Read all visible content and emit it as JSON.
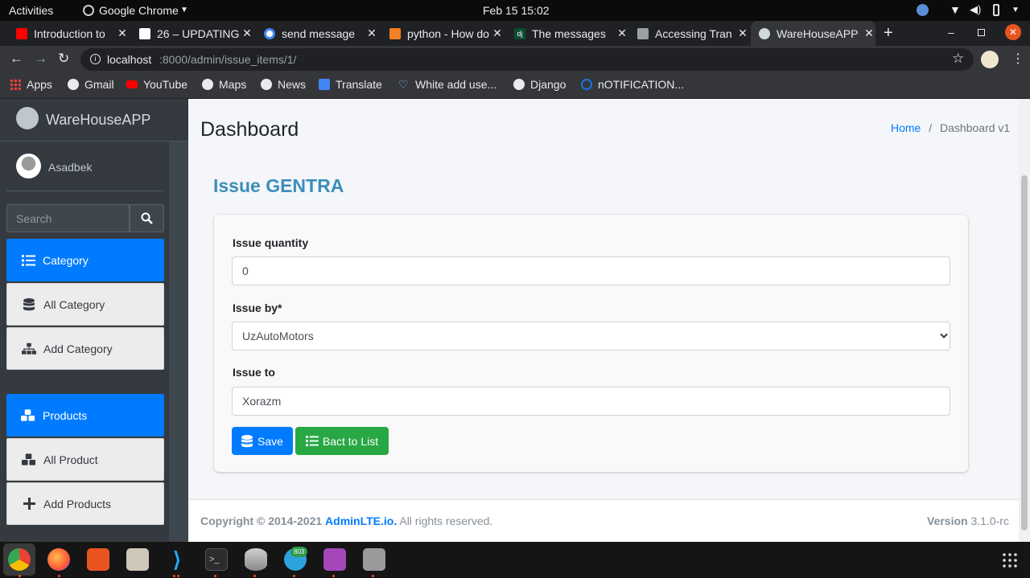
{
  "system": {
    "activities": "Activities",
    "app_name": "Google Chrome",
    "datetime": "Feb 15  15:02"
  },
  "browser": {
    "tabs": [
      {
        "title": "Introduction to",
        "favicon_color": "#ff0000"
      },
      {
        "title": "26 – UPDATING",
        "favicon_color": "#ffffff"
      },
      {
        "title": "send message",
        "favicon_color": "#4285f4"
      },
      {
        "title": "python - How do",
        "favicon_color": "#f48024"
      },
      {
        "title": "The messages",
        "favicon_color": "#0c4b33"
      },
      {
        "title": "Accessing Tran",
        "favicon_color": "#9aa0a6"
      },
      {
        "title": "WareHouseAPP",
        "favicon_color": "#cfd8dc"
      }
    ],
    "url_host": "localhost",
    "url_rest": ":8000/admin/issue_items/1/",
    "bookmarks": [
      "Apps",
      "Gmail",
      "YouTube",
      "Maps",
      "News",
      "Translate",
      "White add use...",
      "Django",
      "nOTIFICATION..."
    ]
  },
  "sidebar": {
    "brand": "WareHouseAPP",
    "user": "Asadbek",
    "search_placeholder": "Search",
    "items": [
      {
        "label": "Category",
        "icon": "list-icon",
        "active": true
      },
      {
        "label": "All Category",
        "icon": "database-icon",
        "active": false
      },
      {
        "label": "Add Category",
        "icon": "sitemap-icon",
        "active": false
      },
      {
        "label": "Products",
        "icon": "cubes-icon",
        "active": true
      },
      {
        "label": "All Product",
        "icon": "cubes-icon",
        "active": false
      },
      {
        "label": "Add Products",
        "icon": "plus-icon",
        "active": false
      }
    ]
  },
  "header": {
    "title": "Dashboard",
    "breadcrumb_home": "Home",
    "breadcrumb_sep": "/",
    "breadcrumb_current": "Dashboard v1"
  },
  "form": {
    "heading": "Issue GENTRA",
    "quantity_label": "Issue quantity",
    "quantity_value": "0",
    "issue_by_label": "Issue by*",
    "issue_by_value": "UzAutoMotors",
    "issue_to_label": "Issue to",
    "issue_to_value": "Xorazm",
    "save_label": "Save",
    "back_label": "Bact to List"
  },
  "footer": {
    "copyright": "Copyright © 2014-2021",
    "brand_link": "AdminLTE.io.",
    "rights": "All rights reserved.",
    "version_label": "Version",
    "version_value": "3.1.0-rc"
  },
  "taskbar": {
    "telegram_badge": "803"
  },
  "colors": {
    "primary": "#007bff",
    "success": "#28a745",
    "sidebar": "#343a40",
    "heading": "#3c8dbc"
  }
}
